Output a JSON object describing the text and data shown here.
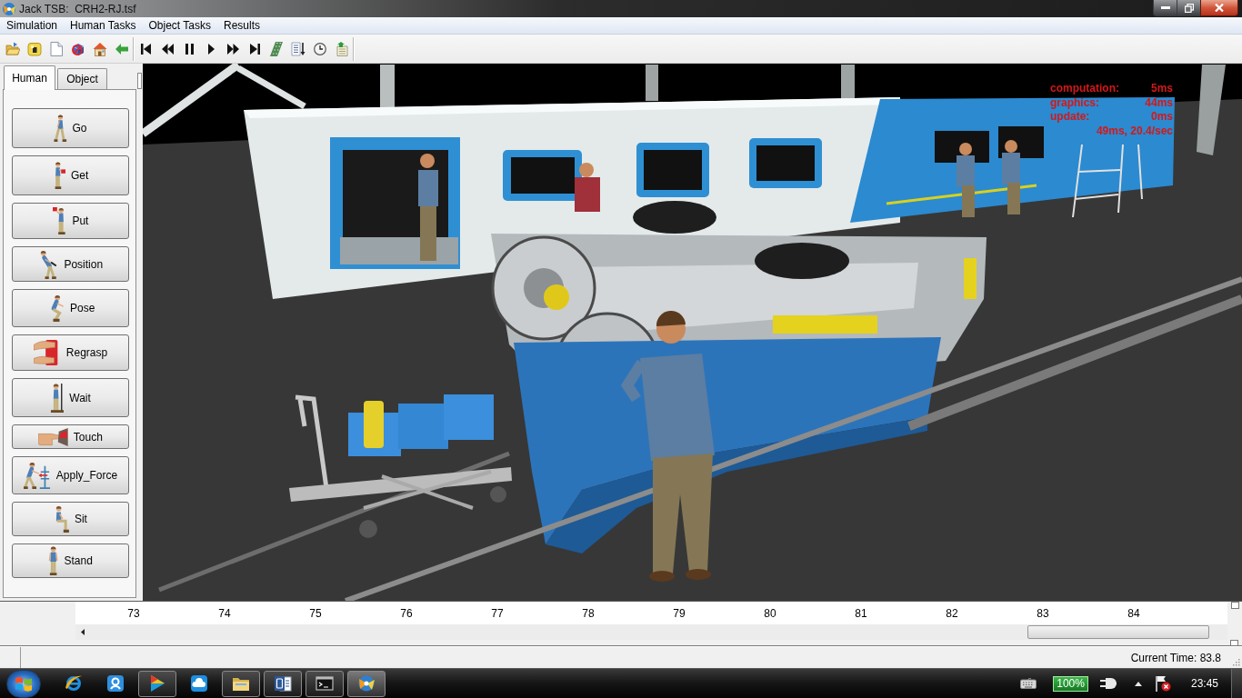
{
  "window": {
    "title": "Jack TSB:  CRH2-RJ.tsf"
  },
  "menu": [
    "Simulation",
    "Human Tasks",
    "Object Tasks",
    "Results"
  ],
  "panel_tabs": [
    {
      "label": "Human",
      "selected": true
    },
    {
      "label": "Object",
      "selected": false
    }
  ],
  "task_buttons": [
    {
      "kind": "go",
      "label": "Go"
    },
    {
      "kind": "get",
      "label": "Get"
    },
    {
      "kind": "put",
      "label": "Put"
    },
    {
      "kind": "position",
      "label": "Position"
    },
    {
      "kind": "pose",
      "label": "Pose"
    },
    {
      "kind": "regrasp",
      "label": "Regrasp"
    },
    {
      "kind": "wait",
      "label": "Wait"
    },
    {
      "kind": "touch",
      "label": "Touch"
    },
    {
      "kind": "apply_force",
      "label": "Apply_Force"
    },
    {
      "kind": "sit",
      "label": "Sit"
    },
    {
      "kind": "stand",
      "label": "Stand"
    }
  ],
  "viewport": {
    "stats": [
      {
        "label": "computation:",
        "value": "5ms"
      },
      {
        "label": "graphics:",
        "value": "44ms"
      },
      {
        "label": "update:",
        "value": "0ms"
      }
    ],
    "frame_rate": "49ms, 20.4/sec"
  },
  "timeline": {
    "ticks": [
      "73",
      "74",
      "75",
      "76",
      "77",
      "78",
      "79",
      "80",
      "81",
      "82",
      "83",
      "84"
    ]
  },
  "status_bar": {
    "current_time": "Current Time: 83.8"
  },
  "taskbar": {
    "apps": [
      {
        "kind": "browser",
        "running": false,
        "selected": false
      },
      {
        "kind": "tile",
        "running": false,
        "selected": false
      },
      {
        "kind": "media",
        "running": true,
        "selected": false
      },
      {
        "kind": "cloud",
        "running": false,
        "selected": false
      },
      {
        "kind": "folder",
        "running": true,
        "selected": false
      },
      {
        "kind": "document",
        "running": true,
        "selected": false
      },
      {
        "kind": "terminal",
        "running": true,
        "selected": false
      },
      {
        "kind": "jack",
        "running": true,
        "selected": true
      }
    ],
    "battery": "100%",
    "clock": "23:45"
  }
}
